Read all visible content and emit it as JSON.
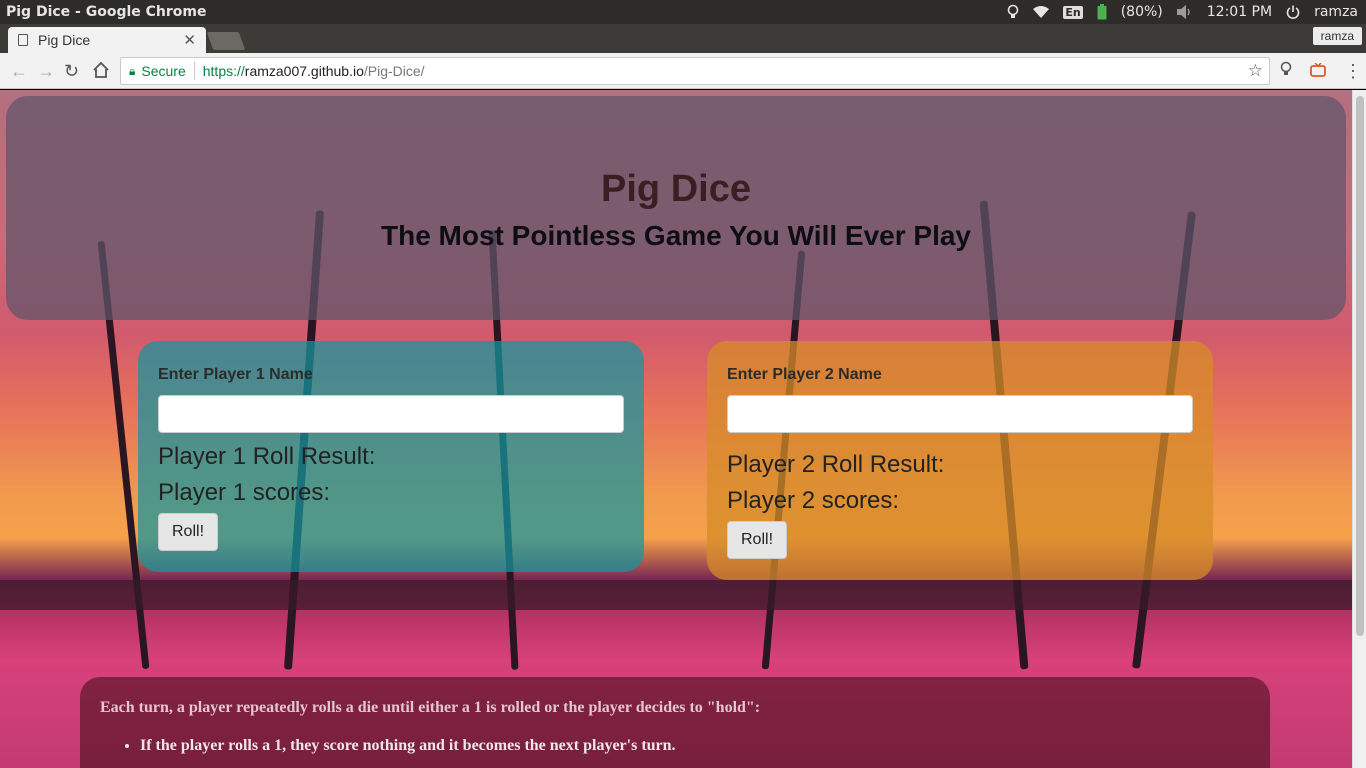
{
  "os": {
    "window_title": "Pig Dice - Google Chrome",
    "keyboard": "En",
    "battery": "(80%)",
    "time": "12:01 PM",
    "user": "ramza"
  },
  "browser": {
    "tab_title": "Pig Dice",
    "profile": "ramza",
    "secure_label": "Secure",
    "url_proto": "https://",
    "url_host": "ramza007.github.io",
    "url_path": "/Pig-Dice/"
  },
  "header": {
    "title": "Pig Dice",
    "subtitle": "The Most Pointless Game You Will Ever Play"
  },
  "player1": {
    "name_label": "Enter Player 1 Name",
    "name_value": "",
    "roll_result_label": "Player 1 Roll Result:",
    "scores_label": "Player 1 scores:",
    "roll_button": "Roll!"
  },
  "player2": {
    "name_label": "Enter Player 2 Name",
    "name_value": "",
    "roll_result_label": "Player 2 Roll Result:",
    "scores_label": "Player 2 scores:",
    "roll_button": "Roll!"
  },
  "rules": {
    "intro": "Each turn, a player repeatedly rolls a die until either a 1 is rolled or the player decides to \"hold\":",
    "items": [
      "If the player rolls a 1, they score nothing and it becomes the next player's turn."
    ]
  },
  "colors": {
    "header_panel": "#5f5569",
    "player1_panel": "#1496a0",
    "player2_panel": "#d78c28",
    "secure_green": "#0b8043"
  }
}
